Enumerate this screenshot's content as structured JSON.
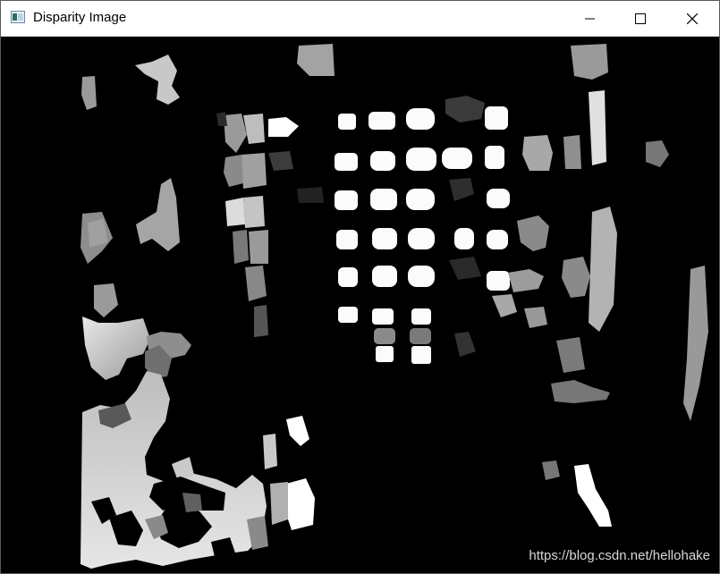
{
  "window": {
    "title": "Disparity Image",
    "icon": "opencv-window-icon",
    "controls": [
      "minimize-icon",
      "maximize-icon",
      "close-icon"
    ]
  },
  "image": {
    "description_type": "disparity-map",
    "watermark": "https://blog.csdn.net/hellohake"
  }
}
